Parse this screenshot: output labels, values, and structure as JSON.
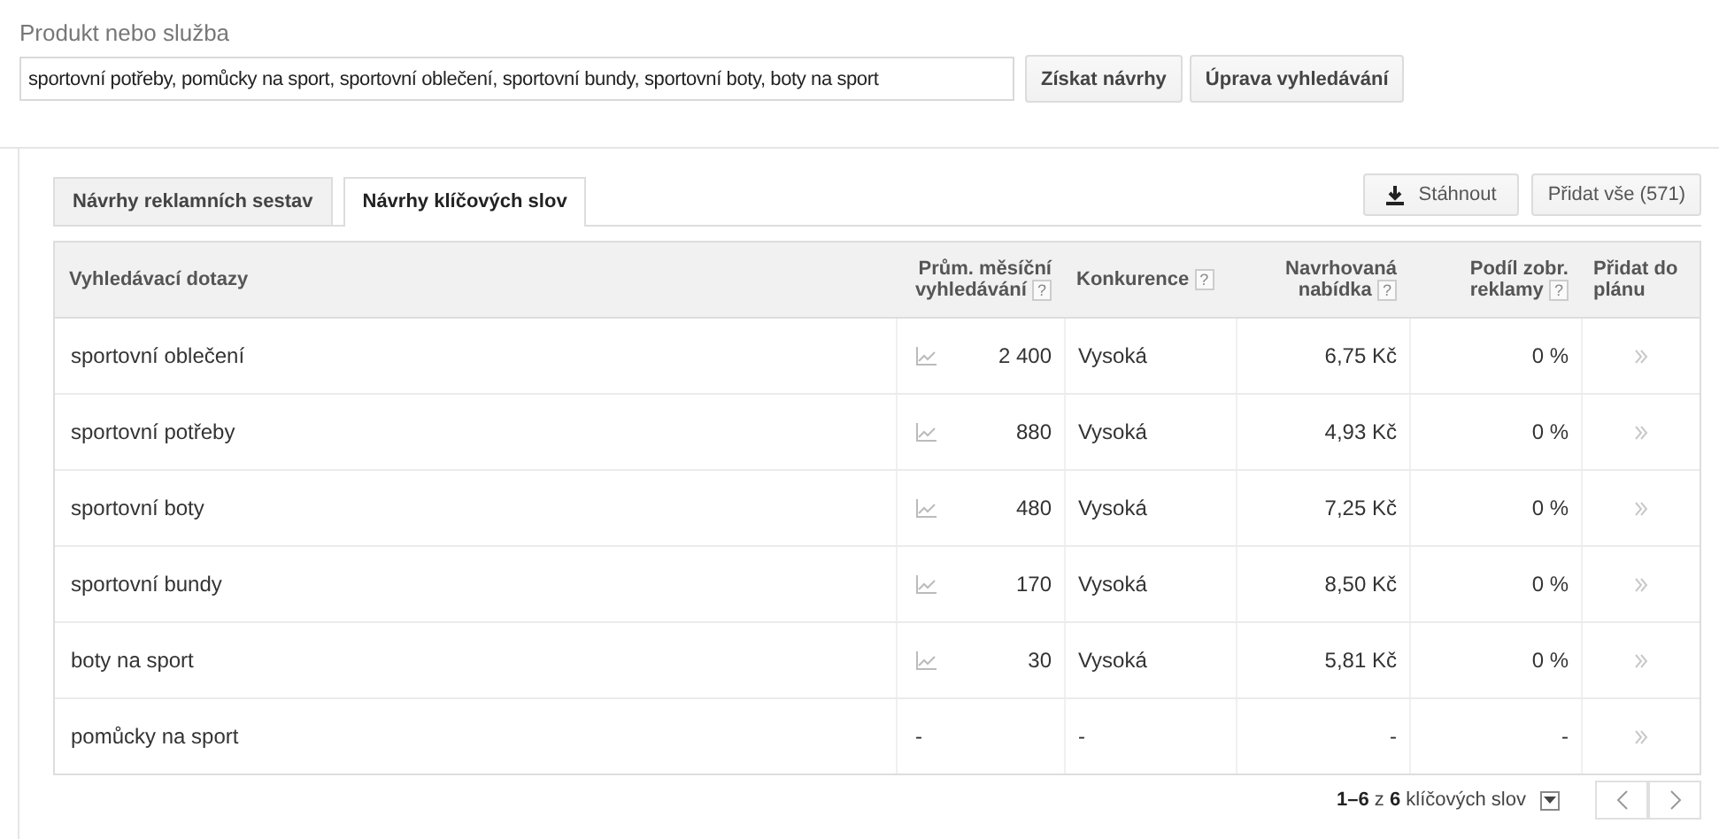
{
  "product": {
    "label": "Produkt nebo služba",
    "value": "sportovní potřeby, pomůcky na sport, sportovní oblečení, sportovní bundy, sportovní boty, boty na sport"
  },
  "search_buttons": [
    "Získat návrhy",
    "Úprava vyhledávání"
  ],
  "tabs": [
    {
      "label": "Návrhy reklamních sestav",
      "selected": false
    },
    {
      "label": "Návrhy klíčových slov",
      "selected": true
    }
  ],
  "actions": {
    "download": "Stáhnout",
    "add_all": "Přidat vše (571)"
  },
  "table": {
    "columns": [
      {
        "label": "Vyhledávací dotazy"
      },
      {
        "label": "Prům. měsíční vyhledávání",
        "help": "?"
      },
      {
        "label": "Konkurence",
        "help": "?"
      },
      {
        "label": "Navrhovaná nabídka",
        "help": "?"
      },
      {
        "label": "Podíl zobr. reklamy",
        "help": "?"
      },
      {
        "label": "Přidat do plánu"
      }
    ],
    "rows": [
      {
        "query": "sportovní oblečení",
        "trend": true,
        "searches": "2 400",
        "competition": "Vysoká",
        "bid": "6,75 Kč",
        "share": "0 %"
      },
      {
        "query": "sportovní potřeby",
        "trend": true,
        "searches": "880",
        "competition": "Vysoká",
        "bid": "4,93 Kč",
        "share": "0 %"
      },
      {
        "query": "sportovní boty",
        "trend": true,
        "searches": "480",
        "competition": "Vysoká",
        "bid": "7,25 Kč",
        "share": "0 %"
      },
      {
        "query": "sportovní bundy",
        "trend": true,
        "searches": "170",
        "competition": "Vysoká",
        "bid": "8,50 Kč",
        "share": "0 %"
      },
      {
        "query": "boty na sport",
        "trend": true,
        "searches": "30",
        "competition": "Vysoká",
        "bid": "5,81 Kč",
        "share": "0 %"
      },
      {
        "query": "pomůcky na sport",
        "trend": false,
        "searches": "-",
        "competition": "-",
        "bid": "-",
        "share": "-"
      }
    ]
  },
  "pagination": "**1–6** z **6** klíčových slov"
}
